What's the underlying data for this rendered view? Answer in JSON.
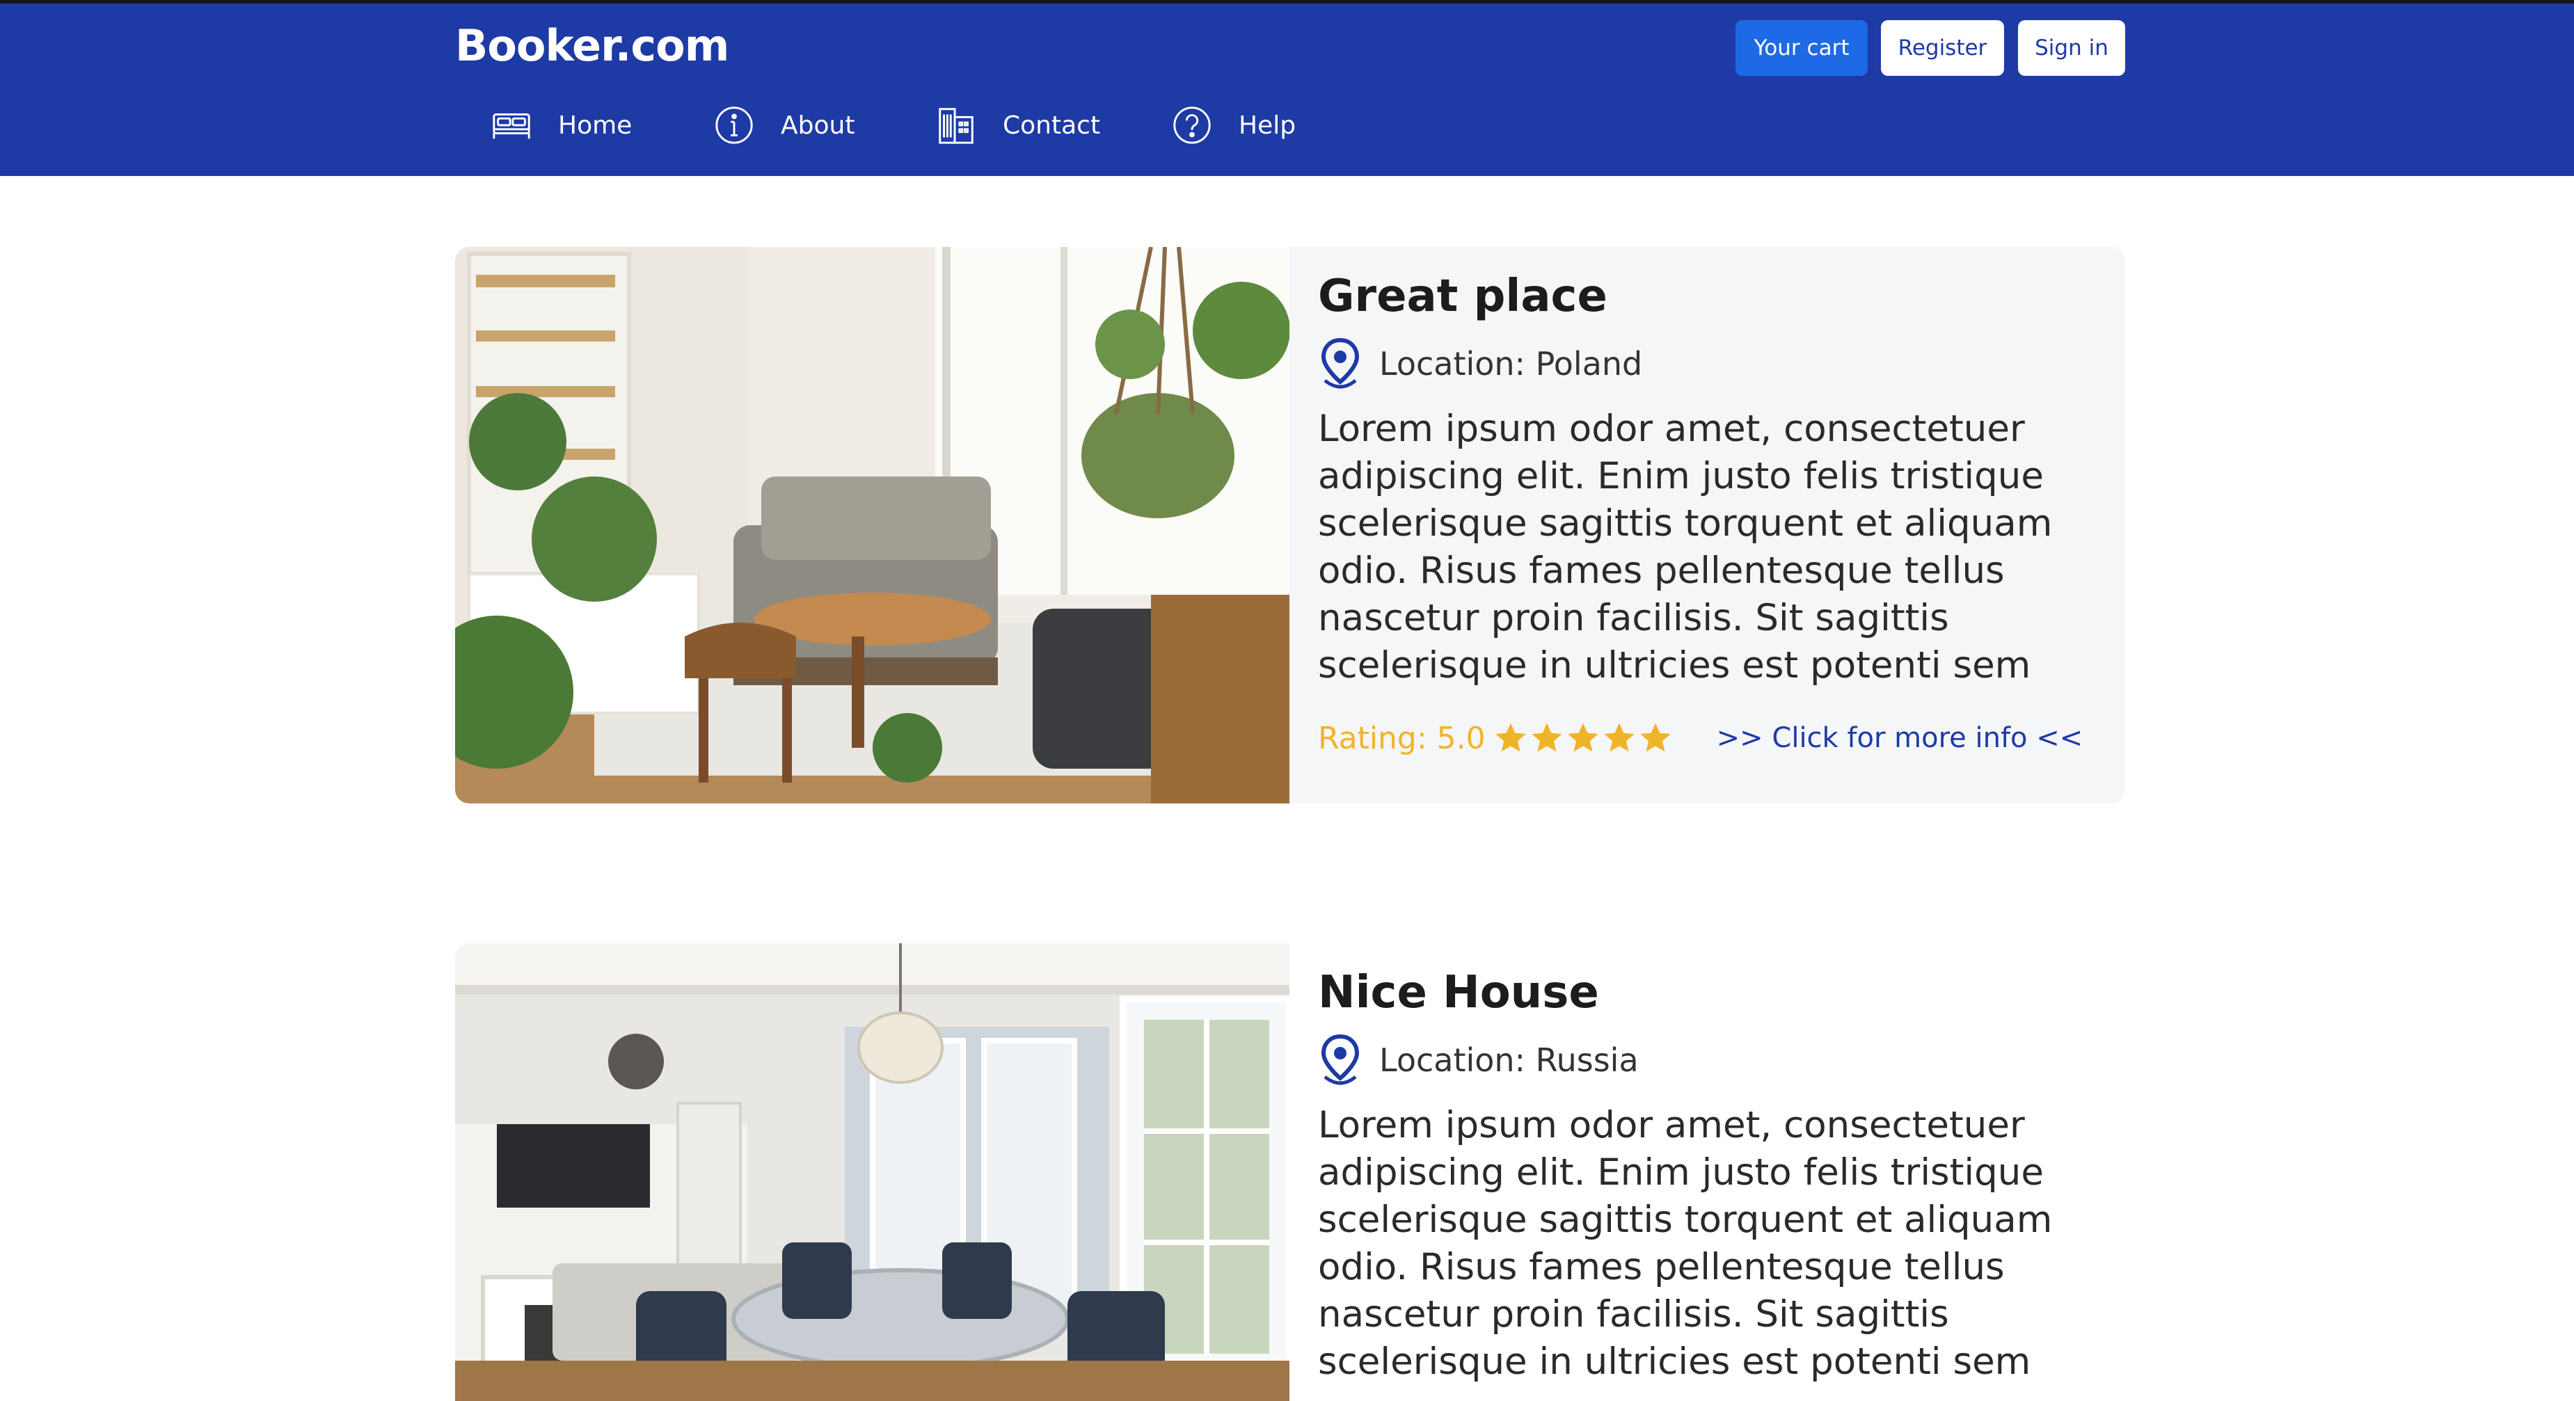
{
  "header": {
    "brand": "Booker.com",
    "buttons": {
      "cart": "Your cart",
      "register": "Register",
      "signin": "Sign in"
    },
    "nav": [
      {
        "label": "Home",
        "icon": "bed-icon"
      },
      {
        "label": "About",
        "icon": "info-icon"
      },
      {
        "label": "Contact",
        "icon": "building-icon"
      },
      {
        "label": "Help",
        "icon": "help-icon"
      }
    ]
  },
  "listings": [
    {
      "title": "Great place",
      "location": "Location: Poland",
      "description": "Lorem ipsum odor amet, consectetuer adipiscing elit. Enim justo felis tristique scelerisque sagittis torquent et aliquam odio. Risus fames pellentesque tellus nascetur proin facilisis. Sit sagittis scelerisque in ultricies est potenti sem ma…",
      "rating": "Rating: 5.0",
      "stars": 5,
      "more_link": ">> Click for more info <<"
    },
    {
      "title": "Nice House",
      "location": "Location: Russia",
      "description": "Lorem ipsum odor amet, consectetuer adipiscing elit. Enim justo felis tristique scelerisque sagittis torquent et aliquam odio. Risus fames pellentesque tellus nascetur proin facilisis. Sit sagittis scelerisque in ultricies est potenti sem ma…"
    }
  ],
  "colors": {
    "header_bg": "#1e3aa5",
    "cart_button": "#1e6ae6",
    "rating": "#f0b428",
    "link": "#1e3aa5"
  }
}
